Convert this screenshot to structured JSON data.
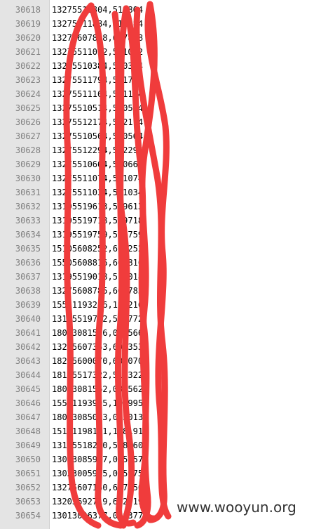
{
  "editor": {
    "lines": [
      {
        "number": "30618",
        "text": "13275511804,511804"
      },
      {
        "number": "30619",
        "text": "13275511884,511884"
      },
      {
        "number": "30620",
        "text": "13275607898,607898"
      },
      {
        "number": "30621",
        "text": "13275511032,511032"
      },
      {
        "number": "30622",
        "text": "13275510384,510384"
      },
      {
        "number": "30623",
        "text": "13275511794,511794"
      },
      {
        "number": "30624",
        "text": "13275511164,511164"
      },
      {
        "number": "30625",
        "text": "13275510514,510514"
      },
      {
        "number": "30626",
        "text": "13275512174,512174"
      },
      {
        "number": "30627",
        "text": "13275510564,510564"
      },
      {
        "number": "30628",
        "text": "13275512294,512294"
      },
      {
        "number": "30629",
        "text": "13275510664,510664"
      },
      {
        "number": "30630",
        "text": "13275511074,511074"
      },
      {
        "number": "30631",
        "text": "13275511034,511034"
      },
      {
        "number": "30632",
        "text": "13195519613,519613"
      },
      {
        "number": "30633",
        "text": "13195519718,519718"
      },
      {
        "number": "30634",
        "text": "13195519759,519759"
      },
      {
        "number": "30635",
        "text": "15105608252,608252"
      },
      {
        "number": "30636",
        "text": "15505608816,608816"
      },
      {
        "number": "30637",
        "text": "13195519018,519018"
      },
      {
        "number": "30638",
        "text": "13275608785,608785"
      },
      {
        "number": "30639",
        "text": "15551193216,193216"
      },
      {
        "number": "30640",
        "text": "13195519772,519772"
      },
      {
        "number": "30641",
        "text": "18013081566,081566"
      },
      {
        "number": "30642",
        "text": "13275607353,607353"
      },
      {
        "number": "30643",
        "text": "18205600070,600070"
      },
      {
        "number": "30644",
        "text": "18155517322,517322"
      },
      {
        "number": "30645",
        "text": "18013081562,081562"
      },
      {
        "number": "30646",
        "text": "15551193995,193995"
      },
      {
        "number": "30647",
        "text": "18013085013,085013"
      },
      {
        "number": "30648",
        "text": "15151198191,198191"
      },
      {
        "number": "30649",
        "text": "13195518260,518260"
      },
      {
        "number": "30650",
        "text": "13013085957,085957"
      },
      {
        "number": "30651",
        "text": "13023005975,005975"
      },
      {
        "number": "30652",
        "text": "13275607150,607150"
      },
      {
        "number": "30653",
        "text": "13205692719,692719"
      },
      {
        "number": "30654",
        "text": "13013096377,096377"
      }
    ]
  },
  "overlay": {
    "scribble_color": "#f03c3c",
    "watermark": "www.wooyun.org"
  }
}
